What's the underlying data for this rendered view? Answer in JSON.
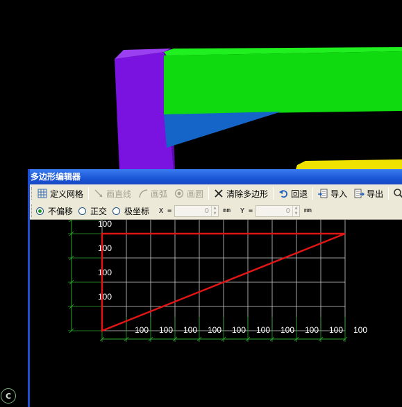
{
  "scene": {
    "corner_badge": "C",
    "colors": {
      "purple": "#7a12e0",
      "green": "#0fd90f",
      "blue": "#1565c8",
      "yellow": "#f0e200"
    }
  },
  "dialog": {
    "title": "多边形编辑器",
    "toolbar": [
      {
        "label": "定义网格",
        "icon": "grid-icon",
        "enabled": true
      },
      {
        "label": "画直线",
        "icon": "line-icon",
        "enabled": false
      },
      {
        "label": "画弧",
        "icon": "arc-icon",
        "enabled": false
      },
      {
        "label": "画圆",
        "icon": "circle-icon",
        "enabled": false
      },
      {
        "label": "清除多边形",
        "icon": "clear-icon",
        "enabled": true
      },
      {
        "label": "回退",
        "icon": "undo-icon",
        "enabled": true
      },
      {
        "label": "导入",
        "icon": "import-icon",
        "enabled": true
      },
      {
        "label": "导出",
        "icon": "export-icon",
        "enabled": true
      }
    ],
    "options": {
      "modes": [
        {
          "label": "不偏移",
          "selected": true
        },
        {
          "label": "正交",
          "selected": false
        },
        {
          "label": "极坐标",
          "selected": false
        }
      ],
      "x_label": "X =",
      "x_value": "0",
      "y_label": "Y =",
      "y_value": "0",
      "unit": "mm"
    },
    "grid": {
      "row_labels": [
        "100",
        "100",
        "100",
        "100"
      ],
      "col_labels": [
        "100",
        "100",
        "100",
        "100",
        "100",
        "100",
        "100",
        "100",
        "100",
        "100"
      ],
      "line_color": "#cfcfcf",
      "dim_color": "#2fa82f",
      "polygon_color": "#e01515"
    }
  }
}
